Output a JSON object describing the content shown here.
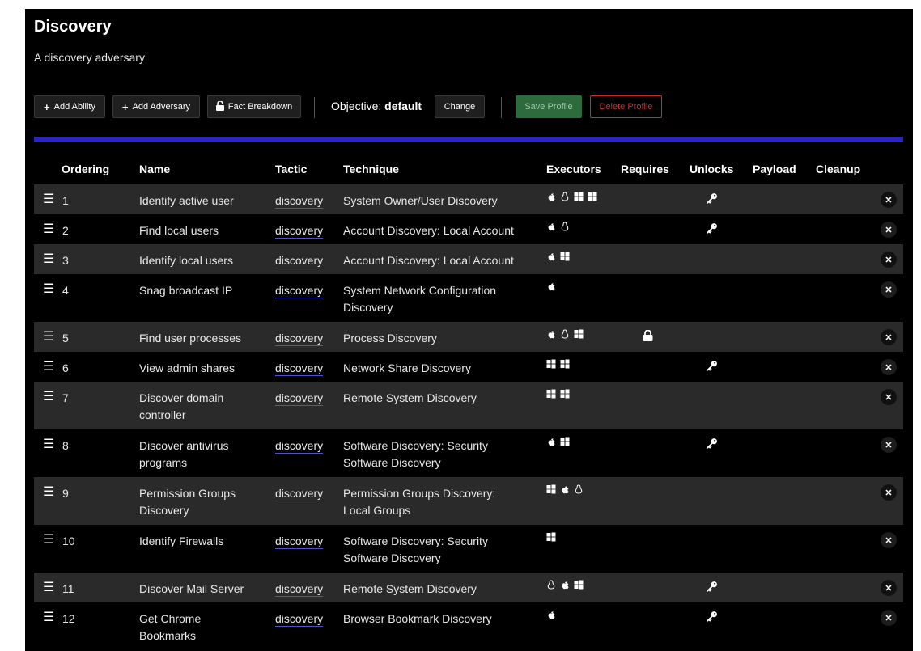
{
  "header": {
    "title": "Discovery",
    "subtitle": "A discovery adversary"
  },
  "toolbar": {
    "add_ability": "Add Ability",
    "add_adversary": "Add Adversary",
    "fact_breakdown": "Fact Breakdown",
    "objective_label": "Objective:",
    "objective_value": "default",
    "change": "Change",
    "save_profile": "Save Profile",
    "delete_profile": "Delete Profile"
  },
  "colors": {
    "accent": "#2a24c6",
    "save": "#2d6a3c",
    "delete": "#d12a2a",
    "row_shade": "#2a2a2a"
  },
  "table": {
    "headers": {
      "ordering": "Ordering",
      "name": "Name",
      "tactic": "Tactic",
      "technique": "Technique",
      "executors": "Executors",
      "requires": "Requires",
      "unlocks": "Unlocks",
      "payload": "Payload",
      "cleanup": "Cleanup"
    },
    "rows": [
      {
        "order": "1",
        "name": [
          "Identify active user"
        ],
        "tactic": "discovery",
        "technique": [
          "System Owner/User Discovery"
        ],
        "executors": [
          "apple",
          "linux",
          "windows",
          "windows"
        ],
        "requires": false,
        "unlocks": true
      },
      {
        "order": "2",
        "name": [
          "Find local users"
        ],
        "tactic": "discovery",
        "technique": [
          "Account Discovery: Local Account"
        ],
        "executors": [
          "apple",
          "linux"
        ],
        "requires": false,
        "unlocks": true
      },
      {
        "order": "3",
        "name": [
          "Identify local users"
        ],
        "tactic": "discovery",
        "technique": [
          "Account Discovery: Local Account"
        ],
        "executors": [
          "apple",
          "windows"
        ],
        "requires": false,
        "unlocks": false
      },
      {
        "order": "4",
        "name": [
          "Snag broadcast IP"
        ],
        "tactic": "discovery",
        "technique": [
          "System Network Configuration",
          "Discovery"
        ],
        "executors": [
          "apple"
        ],
        "requires": false,
        "unlocks": false
      },
      {
        "order": "5",
        "name": [
          "Find user processes"
        ],
        "tactic": "discovery",
        "technique": [
          "Process Discovery"
        ],
        "executors": [
          "apple",
          "linux",
          "windows"
        ],
        "requires": true,
        "unlocks": false
      },
      {
        "order": "6",
        "name": [
          "View admin shares"
        ],
        "tactic": "discovery",
        "technique": [
          "Network Share Discovery"
        ],
        "executors": [
          "windows",
          "windows"
        ],
        "requires": false,
        "unlocks": true
      },
      {
        "order": "7",
        "name": [
          "Discover domain",
          "controller"
        ],
        "tactic": "discovery",
        "technique": [
          "Remote System Discovery"
        ],
        "executors": [
          "windows",
          "windows"
        ],
        "requires": false,
        "unlocks": false
      },
      {
        "order": "8",
        "name": [
          "Discover antivirus",
          "programs"
        ],
        "tactic": "discovery",
        "technique": [
          "Software Discovery: Security",
          "Software Discovery"
        ],
        "executors": [
          "apple",
          "windows"
        ],
        "requires": false,
        "unlocks": true
      },
      {
        "order": "9",
        "name": [
          "Permission Groups",
          "Discovery"
        ],
        "tactic": "discovery",
        "technique": [
          "Permission Groups Discovery:",
          "Local Groups"
        ],
        "executors": [
          "windows",
          "apple",
          "linux"
        ],
        "requires": false,
        "unlocks": false
      },
      {
        "order": "10",
        "name": [
          "Identify Firewalls"
        ],
        "tactic": "discovery",
        "technique": [
          "Software Discovery: Security",
          "Software Discovery"
        ],
        "executors": [
          "windows"
        ],
        "requires": false,
        "unlocks": false
      },
      {
        "order": "11",
        "name": [
          "Discover Mail Server"
        ],
        "tactic": "discovery",
        "technique": [
          "Remote System Discovery"
        ],
        "executors": [
          "linux",
          "apple",
          "windows"
        ],
        "requires": false,
        "unlocks": true
      },
      {
        "order": "12",
        "name": [
          "Get Chrome",
          "Bookmarks"
        ],
        "tactic": "discovery",
        "technique": [
          "Browser Bookmark Discovery"
        ],
        "executors": [
          "apple"
        ],
        "requires": false,
        "unlocks": true
      }
    ]
  }
}
